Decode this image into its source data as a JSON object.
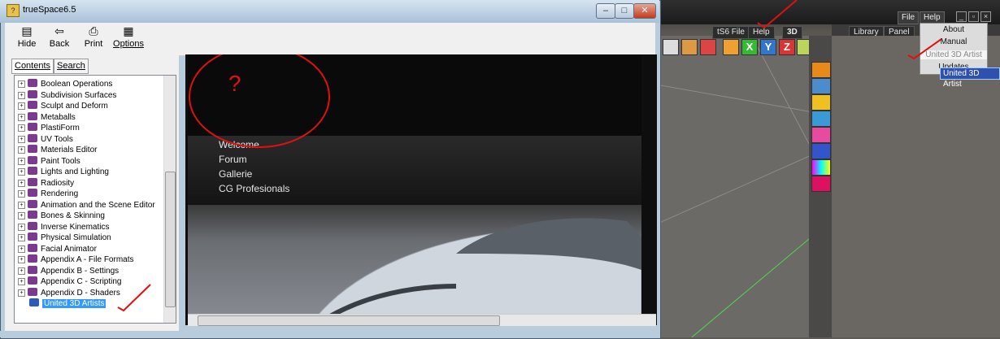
{
  "help_window": {
    "title": "trueSpace6.5",
    "toolbar": [
      {
        "label": "Hide",
        "icon": "hide-icon"
      },
      {
        "label": "Back",
        "icon": "back-arrow-icon"
      },
      {
        "label": "Print",
        "icon": "printer-icon"
      },
      {
        "label": "Options",
        "icon": "options-icon"
      }
    ],
    "tabs": [
      "Contents",
      "Search"
    ],
    "tree": [
      "Boolean Operations",
      "Subdivision Surfaces",
      "Sculpt and Deform",
      "Metaballs",
      "PlastiForm",
      "UV Tools",
      "Materials Editor",
      "Paint Tools",
      "Lights and Lighting",
      "Radiosity",
      "Rendering",
      "Animation and the Scene Editor",
      "Bones & Skinning",
      "Inverse Kinematics",
      "Physical Simulation",
      "Facial Animator",
      "Appendix A - File Formats",
      "Appendix B - Settings",
      "Appendix C - Scripting",
      "Appendix D - Shaders"
    ],
    "selected_item": "United 3D Artists",
    "content_nav": [
      "Welcome",
      "Forum",
      "Gallerie",
      "CG Profesionals"
    ],
    "annotation_mark": "?"
  },
  "truespace": {
    "toolbar_buttons": [
      "tS6 File",
      "Help",
      "3D"
    ],
    "menu": [
      "File",
      "Help"
    ],
    "panel_tabs": [
      "Library",
      "Panel"
    ],
    "help_dropdown": [
      "About",
      "Manual",
      "United 3D Artist",
      "Updates"
    ],
    "tooltip": "United 3D Artist"
  },
  "colors": {
    "selection": "#3399ff",
    "annotation_red": "#e01010",
    "book_icon": "#7a3b8e"
  }
}
